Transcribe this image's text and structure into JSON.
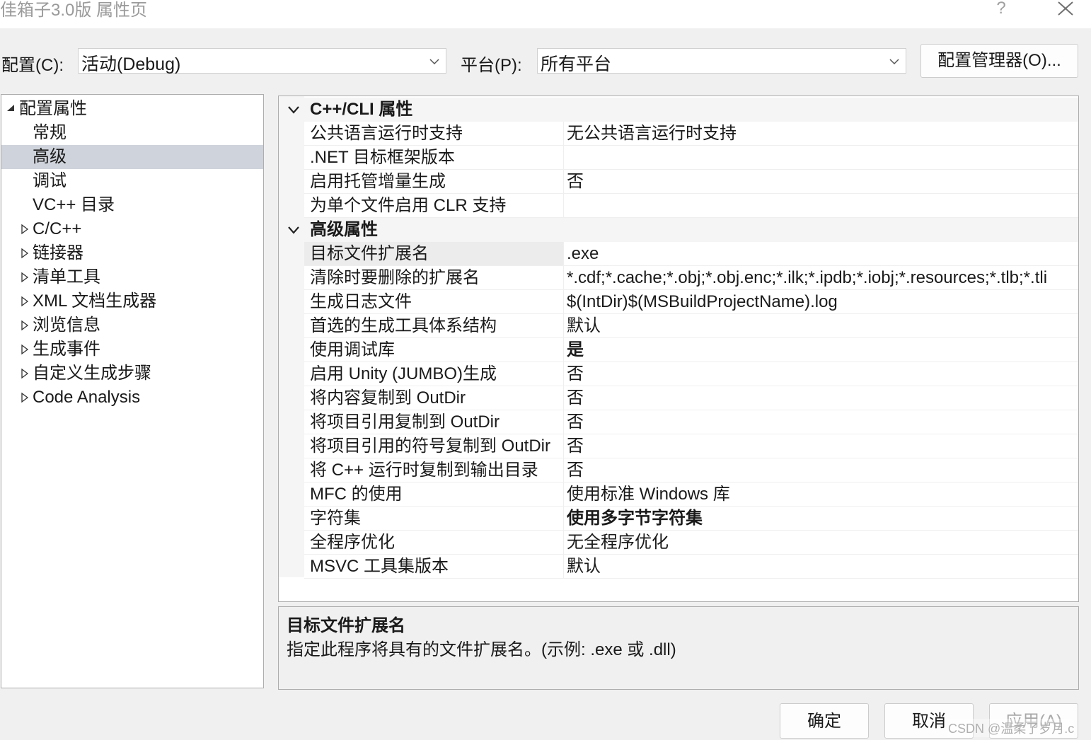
{
  "window": {
    "title": "佳箱子3.0版 属性页",
    "help_label": "?"
  },
  "toolbar": {
    "config_label": "配置(C):",
    "config_value": "活动(Debug)",
    "platform_label": "平台(P):",
    "platform_value": "所有平台",
    "config_manager_label": "配置管理器(O)..."
  },
  "tree": {
    "items": [
      {
        "label": "配置属性",
        "arrow": "expanded"
      },
      {
        "label": "常规",
        "arrow": "none"
      },
      {
        "label": "高级",
        "arrow": "none",
        "selected": true
      },
      {
        "label": "调试",
        "arrow": "none"
      },
      {
        "label": "VC++ 目录",
        "arrow": "none"
      },
      {
        "label": "C/C++",
        "arrow": "collapsed"
      },
      {
        "label": "链接器",
        "arrow": "collapsed"
      },
      {
        "label": "清单工具",
        "arrow": "collapsed"
      },
      {
        "label": "XML 文档生成器",
        "arrow": "collapsed"
      },
      {
        "label": "浏览信息",
        "arrow": "collapsed"
      },
      {
        "label": "生成事件",
        "arrow": "collapsed"
      },
      {
        "label": "自定义生成步骤",
        "arrow": "collapsed"
      },
      {
        "label": "Code Analysis",
        "arrow": "collapsed"
      }
    ]
  },
  "grid": {
    "categories": [
      {
        "title": "C++/CLI 属性",
        "rows": [
          {
            "name": "公共语言运行时支持",
            "value": "无公共语言运行时支持"
          },
          {
            "name": ".NET 目标框架版本",
            "value": ""
          },
          {
            "name": "启用托管增量生成",
            "value": "否"
          },
          {
            "name": "为单个文件启用 CLR 支持",
            "value": ""
          }
        ]
      },
      {
        "title": "高级属性",
        "rows": [
          {
            "name": "目标文件扩展名",
            "value": ".exe",
            "selected": true
          },
          {
            "name": "清除时要删除的扩展名",
            "value": "*.cdf;*.cache;*.obj;*.obj.enc;*.ilk;*.ipdb;*.iobj;*.resources;*.tlb;*.tli"
          },
          {
            "name": "生成日志文件",
            "value": "$(IntDir)$(MSBuildProjectName).log"
          },
          {
            "name": "首选的生成工具体系结构",
            "value": "默认"
          },
          {
            "name": "使用调试库",
            "value": "是",
            "bold": true
          },
          {
            "name": "启用 Unity (JUMBO)生成",
            "value": "否"
          },
          {
            "name": "将内容复制到 OutDir",
            "value": "否"
          },
          {
            "name": "将项目引用复制到 OutDir",
            "value": "否"
          },
          {
            "name": "将项目引用的符号复制到 OutDir",
            "value": "否"
          },
          {
            "name": "将 C++ 运行时复制到输出目录",
            "value": "否"
          },
          {
            "name": "MFC 的使用",
            "value": "使用标准 Windows 库"
          },
          {
            "name": "字符集",
            "value": "使用多字节字符集",
            "bold": true
          },
          {
            "name": "全程序优化",
            "value": "无全程序优化"
          },
          {
            "name": "MSVC 工具集版本",
            "value": "默认"
          }
        ]
      }
    ]
  },
  "description": {
    "title": "目标文件扩展名",
    "text": "指定此程序将具有的文件扩展名。(示例: .exe 或 .dll)"
  },
  "buttons": {
    "ok": "确定",
    "cancel": "取消",
    "apply": "应用(A)"
  },
  "watermark": "CSDN @温柔了岁月.c",
  "colors": {
    "selection": "#cfd3db",
    "border": "#adadad",
    "background": "#f0f0f0"
  }
}
